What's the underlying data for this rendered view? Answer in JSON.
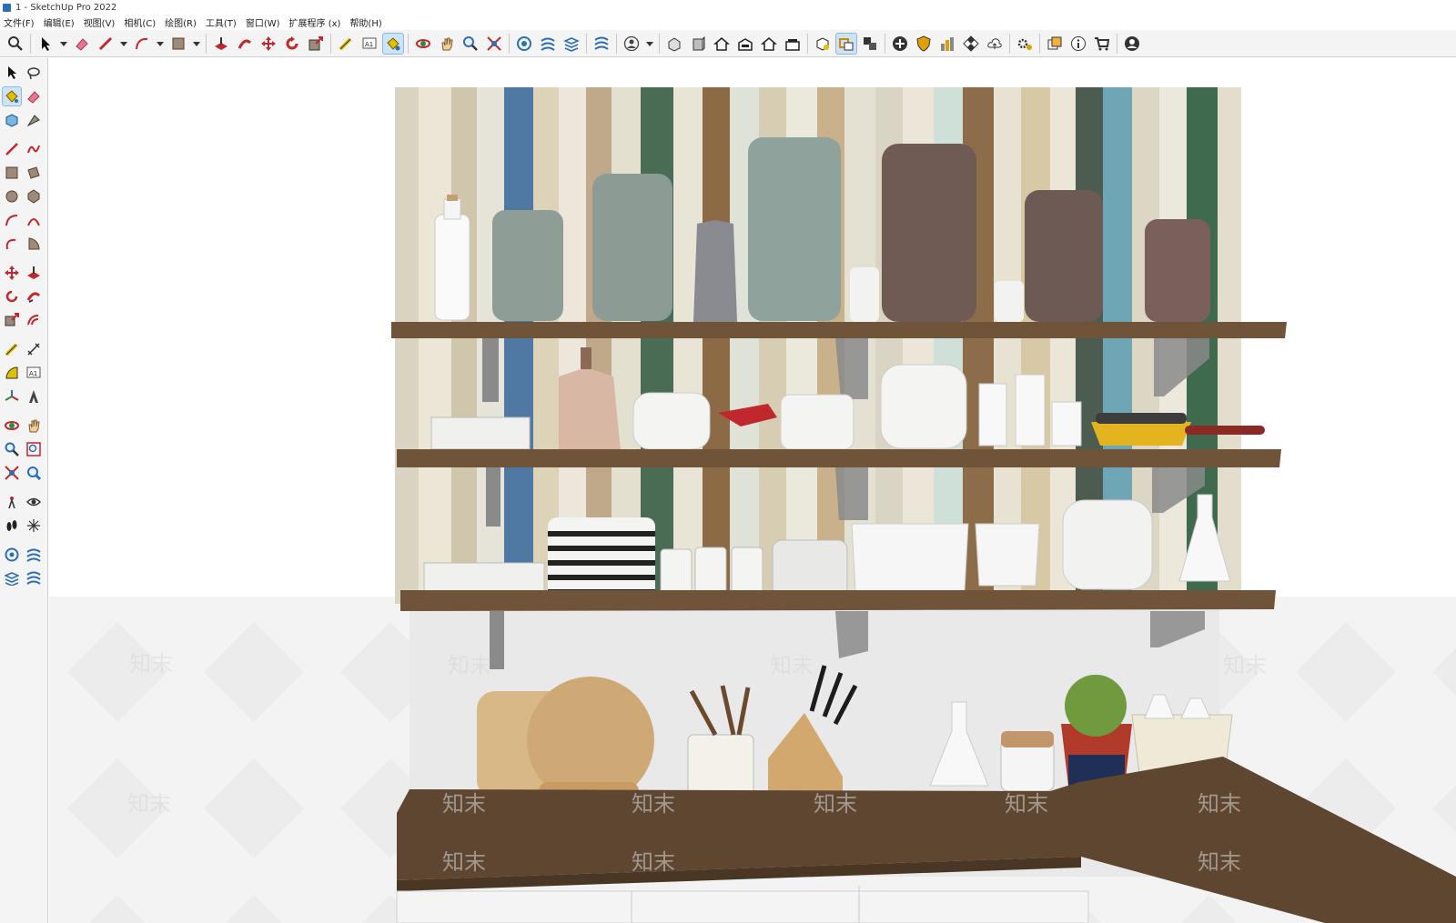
{
  "window": {
    "title": "1 - SketchUp Pro 2022"
  },
  "menu": [
    {
      "label": "文件(F)"
    },
    {
      "label": "编辑(E)"
    },
    {
      "label": "视图(V)"
    },
    {
      "label": "相机(C)"
    },
    {
      "label": "绘图(R)"
    },
    {
      "label": "工具(T)"
    },
    {
      "label": "窗口(W)"
    },
    {
      "label": "扩展程序 (x)"
    },
    {
      "label": "帮助(H)"
    }
  ],
  "toolbar": {
    "text_tool_glyph": "A1"
  },
  "watermark": {
    "text": "知末"
  },
  "colors": {
    "accent": "#2d6db5",
    "active_tool": "#cde3f7",
    "shelf_wood": "#6f543a",
    "counter_top": "#5e4630",
    "bracket": "#8a8a8a",
    "backsplash": "#e8e8e8"
  }
}
